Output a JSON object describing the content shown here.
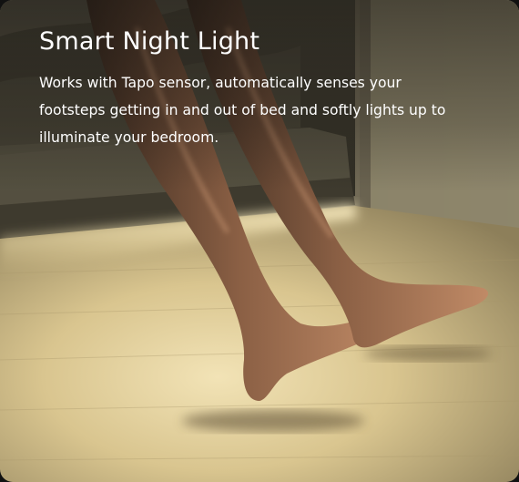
{
  "card": {
    "title": "Smart Night Light",
    "description": "Works with Tapo sensor, automatically senses your footsteps getting in and out of bed and softly lights up to illuminate your bedroom."
  },
  "colors": {
    "text": "#ffffff",
    "floor_light": "#e8d8a8",
    "room_shadow": "#3a352c"
  }
}
